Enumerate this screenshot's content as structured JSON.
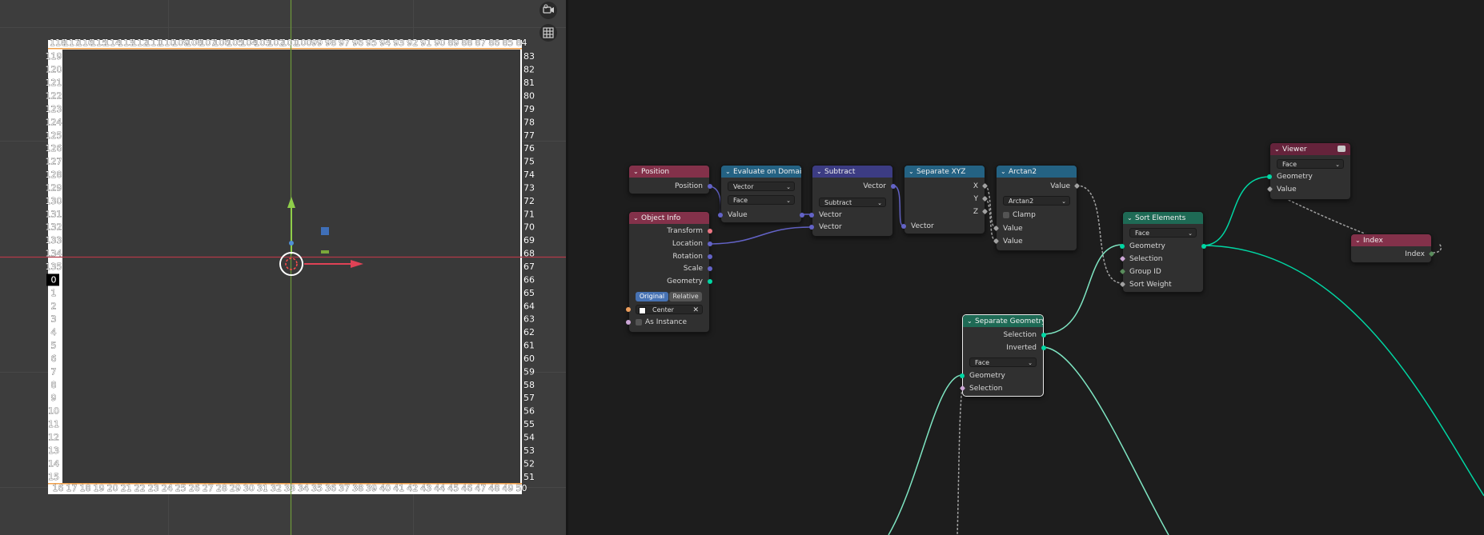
{
  "viewport": {
    "top_numbers": [
      "118",
      "117",
      "116",
      "115",
      "114",
      "113",
      "112",
      "111",
      "110",
      "109",
      "108",
      "107",
      "106",
      "105",
      "104",
      "103",
      "102",
      "101",
      "100",
      "99",
      "98",
      "97",
      "96",
      "95",
      "94",
      "93",
      "92",
      "91",
      "90",
      "89",
      "88",
      "87",
      "86",
      "85",
      "84"
    ],
    "left_numbers": [
      "119",
      "120",
      "121",
      "122",
      "123",
      "124",
      "125",
      "126",
      "127",
      "128",
      "129",
      "130",
      "131",
      "132",
      "133",
      "134",
      "135",
      "0",
      "1",
      "2",
      "3",
      "4",
      "5",
      "6",
      "7",
      "8",
      "9",
      "10",
      "11",
      "12",
      "13",
      "14",
      "15"
    ],
    "right_numbers": [
      "83",
      "82",
      "81",
      "80",
      "79",
      "78",
      "77",
      "76",
      "75",
      "74",
      "73",
      "72",
      "71",
      "70",
      "69",
      "68",
      "67",
      "66",
      "65",
      "64",
      "63",
      "62",
      "61",
      "60",
      "59",
      "58",
      "57",
      "56",
      "55",
      "54",
      "53",
      "52",
      "51"
    ],
    "bottom_numbers": [
      "16",
      "17",
      "18",
      "19",
      "20",
      "21",
      "22",
      "23",
      "24",
      "25",
      "26",
      "27",
      "28",
      "29",
      "30",
      "31",
      "32",
      "33",
      "34",
      "35",
      "36",
      "37",
      "38",
      "39",
      "40",
      "41",
      "42",
      "43",
      "44",
      "45",
      "46",
      "47",
      "48",
      "49",
      "50"
    ],
    "highlighted_number": "0",
    "icons": {
      "camera": "camera-icon",
      "grid": "grid-icon"
    }
  },
  "nodes": {
    "position": {
      "title": "Position",
      "out": "Position"
    },
    "evaluate": {
      "title": "Evaluate on Domain",
      "type": "Vector",
      "domain": "Face",
      "in_value": "Value",
      "out_value": "Value"
    },
    "subtract": {
      "title": "Subtract",
      "out": "Vector",
      "op": "Subtract",
      "in1": "Vector",
      "in2": "Vector"
    },
    "separate_xyz": {
      "title": "Separate XYZ",
      "x": "X",
      "y": "Y",
      "z": "Z",
      "in": "Vector"
    },
    "arctan2": {
      "title": "Arctan2",
      "out": "Value",
      "op": "Arctan2",
      "clamp": "Clamp",
      "in1": "Value",
      "in2": "Value"
    },
    "object_info": {
      "title": "Object Info",
      "transform": "Transform",
      "location": "Location",
      "rotation": "Rotation",
      "scale": "Scale",
      "geometry": "Geometry",
      "original": "Original",
      "relative": "Relative",
      "object": "Center",
      "as_instance": "As Instance"
    },
    "sort_elements": {
      "title": "Sort Elements",
      "domain": "Face",
      "out_geometry": "Geometry",
      "in_geometry": "Geometry",
      "selection": "Selection",
      "group_id": "Group ID",
      "sort_weight": "Sort Weight"
    },
    "separate_geometry": {
      "title": "Separate Geometry",
      "selection_out": "Selection",
      "inverted": "Inverted",
      "domain": "Face",
      "in_geometry": "Geometry",
      "in_selection": "Selection"
    },
    "viewer": {
      "title": "Viewer",
      "domain": "Face",
      "geometry": "Geometry",
      "value": "Value"
    },
    "index": {
      "title": "Index",
      "out": "Index"
    }
  },
  "colors": {
    "input_header": "#83314a",
    "vector_header": "#3c3c83",
    "converter_header": "#246283",
    "geometry_header": "#1e6a55",
    "output_header": "#65233b",
    "geometry_socket": "#00d6a3",
    "vector_socket": "#6363c7",
    "x_axis": "#d94b5c",
    "y_axis": "#79b33a"
  }
}
